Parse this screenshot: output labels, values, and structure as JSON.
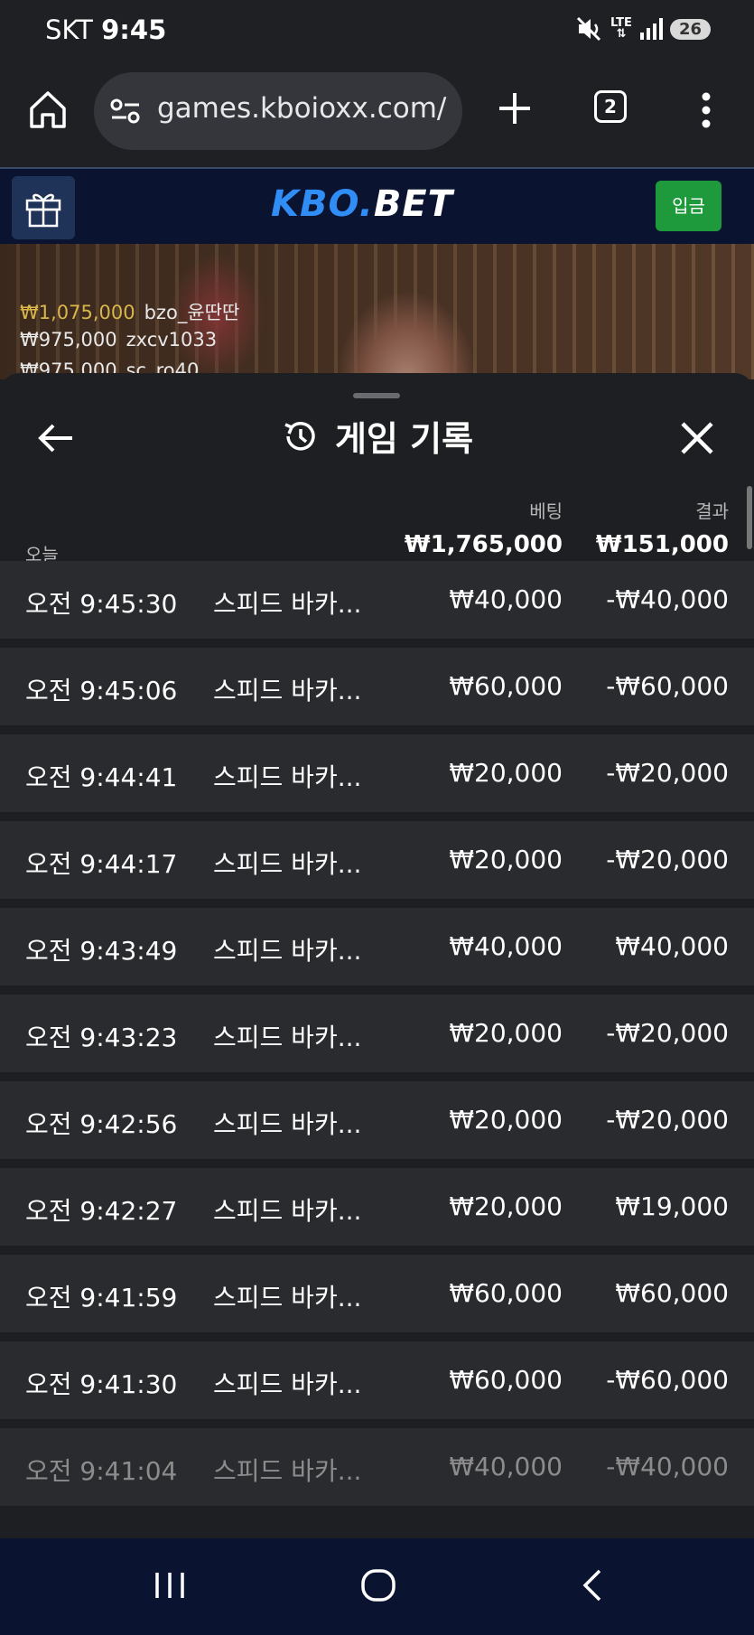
{
  "status": {
    "carrier": "SKT",
    "time": "9:45",
    "lte": "LTE",
    "battery": "26"
  },
  "browser": {
    "url": "games.kboioxx.com/",
    "tab_count": "2"
  },
  "site": {
    "logo_part1": "KBO.",
    "logo_part2": "BET",
    "deposit_label": "입금"
  },
  "video_feed": {
    "wins": [
      {
        "amount": "₩1,075,000",
        "user": "bzo_윤딴딴"
      },
      {
        "amount": "₩975,000",
        "user": "zxcv1033"
      },
      {
        "amount": "₩975,000",
        "user": "sc_ro40"
      }
    ]
  },
  "sheet": {
    "title": "게임 기록",
    "today_label": "오늘",
    "bet_label": "베팅",
    "result_label": "결과",
    "total_bet": "₩1,765,000",
    "total_result": "₩151,000"
  },
  "records": [
    {
      "time": "오전 9:45:30",
      "game": "스피드 바카...",
      "bet": "₩40,000",
      "result": "-₩40,000"
    },
    {
      "time": "오전 9:45:06",
      "game": "스피드 바카...",
      "bet": "₩60,000",
      "result": "-₩60,000"
    },
    {
      "time": "오전 9:44:41",
      "game": "스피드 바카...",
      "bet": "₩20,000",
      "result": "-₩20,000"
    },
    {
      "time": "오전 9:44:17",
      "game": "스피드 바카...",
      "bet": "₩20,000",
      "result": "-₩20,000"
    },
    {
      "time": "오전 9:43:49",
      "game": "스피드 바카...",
      "bet": "₩40,000",
      "result": "₩40,000"
    },
    {
      "time": "오전 9:43:23",
      "game": "스피드 바카...",
      "bet": "₩20,000",
      "result": "-₩20,000"
    },
    {
      "time": "오전 9:42:56",
      "game": "스피드 바카...",
      "bet": "₩20,000",
      "result": "-₩20,000"
    },
    {
      "time": "오전 9:42:27",
      "game": "스피드 바카...",
      "bet": "₩20,000",
      "result": "₩19,000"
    },
    {
      "time": "오전 9:41:59",
      "game": "스피드 바카...",
      "bet": "₩60,000",
      "result": "₩60,000"
    },
    {
      "time": "오전 9:41:30",
      "game": "스피드 바카...",
      "bet": "₩60,000",
      "result": "-₩60,000"
    },
    {
      "time": "오전 9:41:04",
      "game": "스피드 바카...",
      "bet": "₩40,000",
      "result": "-₩40,000"
    }
  ],
  "icons": {
    "home": "home-icon",
    "tune": "tune-icon",
    "plus": "plus-icon",
    "menu": "more-vert-icon",
    "gift": "gift-icon",
    "back": "arrow-left-icon",
    "history": "history-icon",
    "close": "close-icon",
    "nav_recents": "recents-icon",
    "nav_home": "nav-home-icon",
    "nav_back": "nav-back-icon"
  },
  "colors": {
    "accent_blue": "#2f8df5",
    "deposit_green": "#1e9a3c",
    "win_gold": "#d9b64a"
  }
}
